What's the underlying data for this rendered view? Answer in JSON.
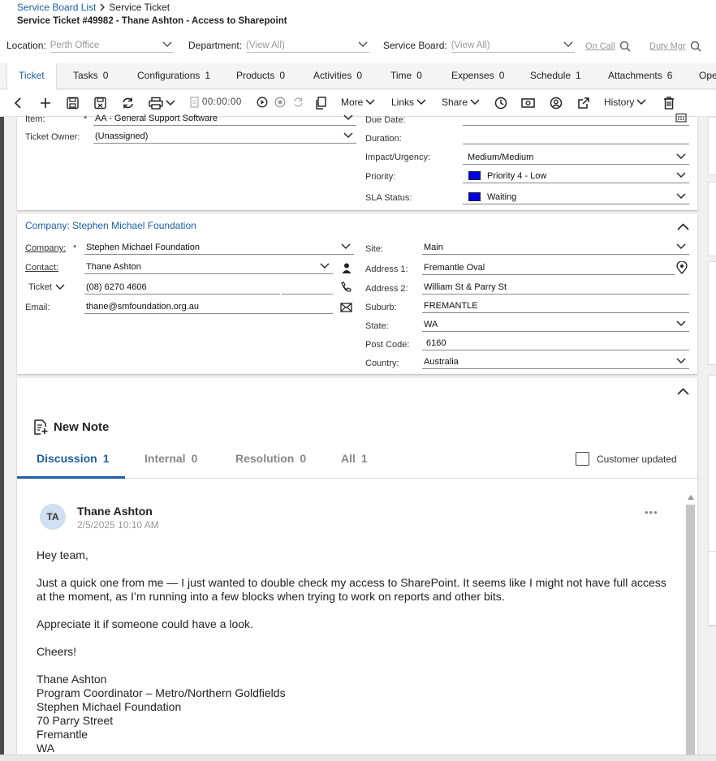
{
  "breadcrumb": {
    "list_link": "Service Board List",
    "current": "Service Ticket"
  },
  "page_title": "Service Ticket #49982 - Thane Ashton - Access to Sharepoint",
  "filters": {
    "location_label": "Location:",
    "location_value": "Perth Office",
    "department_label": "Department:",
    "department_value": "(View All)",
    "board_label": "Service Board:",
    "board_value": "(View All)",
    "on_call": "On Call",
    "duty_mgr": "Duty Mgr"
  },
  "tabs": [
    {
      "label": "Ticket",
      "count": ""
    },
    {
      "label": "Tasks",
      "count": "0"
    },
    {
      "label": "Configurations",
      "count": "1"
    },
    {
      "label": "Products",
      "count": "0"
    },
    {
      "label": "Activities",
      "count": "0"
    },
    {
      "label": "Time",
      "count": "0"
    },
    {
      "label": "Expenses",
      "count": "0"
    },
    {
      "label": "Schedule",
      "count": "1"
    },
    {
      "label": "Attachments",
      "count": "6"
    },
    {
      "label": "Oper",
      "count": ""
    }
  ],
  "toolbar": {
    "timer": "00:00:00",
    "more": "More",
    "links": "Links",
    "share": "Share",
    "history": "History"
  },
  "ticket_fields": {
    "item_label": "Item:",
    "item_value": "AA - General Support Software",
    "owner_label": "Ticket Owner:",
    "owner_value": "(Unassigned)",
    "due_label": "Due Date:",
    "due_value": "",
    "duration_label": "Duration:",
    "duration_value": "",
    "impact_label": "Impact/Urgency:",
    "impact_value": "Medium/Medium",
    "priority_label": "Priority:",
    "priority_value": "Priority 4 - Low",
    "sla_label": "SLA Status:",
    "sla_value": "Waiting",
    "priority_color": "#0000e6"
  },
  "company": {
    "section_title": "Company: Stephen Michael Foundation",
    "company_label": "Company:",
    "company_value": "Stephen Michael Foundation",
    "contact_label": "Contact:",
    "contact_value": "Thane Ashton",
    "phone_type": "Ticket",
    "phone_value": "(08) 6270 4606",
    "email_label": "Email:",
    "email_value": "thane@smfoundation.org.au",
    "site_label": "Site:",
    "site_value": "Main",
    "addr1_label": "Address 1:",
    "addr1_value": "Fremantle Oval",
    "addr2_label": "Address 2:",
    "addr2_value": "William St & Parry St",
    "suburb_label": "Suburb:",
    "suburb_value": "FREMANTLE",
    "state_label": "State:",
    "state_value": "WA",
    "postcode_label": "Post Code:",
    "postcode_value": "6160",
    "country_label": "Country:",
    "country_value": "Australia"
  },
  "notes": {
    "new_note": "New Note",
    "tabs": [
      {
        "label": "Discussion",
        "count": "1"
      },
      {
        "label": "Internal",
        "count": "0"
      },
      {
        "label": "Resolution",
        "count": "0"
      },
      {
        "label": "All",
        "count": "1"
      }
    ],
    "customer_updated": "Customer updated",
    "entry": {
      "initials": "TA",
      "author": "Thane Ashton",
      "date": "2/5/2025 10:10 AM",
      "lines": [
        "Hey team,",
        "Just a quick one from me — I just wanted to double check my access to SharePoint. It seems like I might not have full access",
        "at the moment, as I’m running into a few blocks when trying to work on reports and other bits.",
        "Appreciate it if someone could have a look.",
        "Cheers!",
        "Thane Ashton",
        "Program Coordinator – Metro/Northern Goldfields",
        "Stephen Michael Foundation",
        "70 Parry Street",
        "Fremantle",
        "WA"
      ]
    }
  }
}
